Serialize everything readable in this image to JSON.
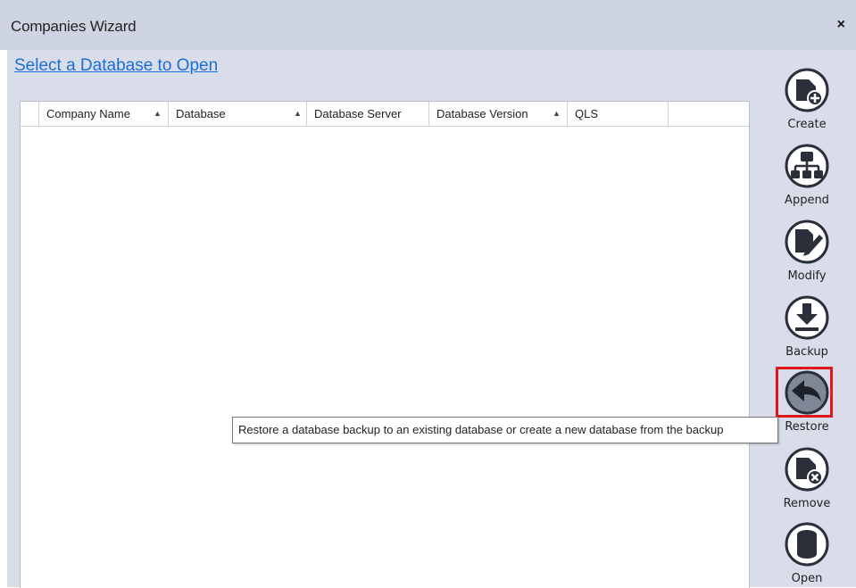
{
  "window": {
    "title": "Companies Wizard",
    "close_label": "×"
  },
  "main": {
    "heading": "Select a Database to Open"
  },
  "grid": {
    "columns": [
      {
        "label": "Company Name",
        "sort": "▲"
      },
      {
        "label": "Database",
        "sort": "▲"
      },
      {
        "label": "Database Server",
        "sort": ""
      },
      {
        "label": "Database Version",
        "sort": "▲"
      },
      {
        "label": "QLS",
        "sort": ""
      },
      {
        "label": "",
        "sort": ""
      }
    ],
    "rows": []
  },
  "actions": [
    {
      "label": "Create",
      "icon": "create-database-icon"
    },
    {
      "label": "Append",
      "icon": "append-hierarchy-icon"
    },
    {
      "label": "Modify",
      "icon": "modify-pencil-icon"
    },
    {
      "label": "Backup",
      "icon": "backup-download-icon"
    },
    {
      "label": "Restore",
      "icon": "restore-undo-icon",
      "highlighted": true
    },
    {
      "label": "Remove",
      "icon": "remove-database-icon"
    },
    {
      "label": "Open",
      "icon": "open-database-icon"
    }
  ],
  "tooltip": {
    "text": "Restore a database backup to an existing database or create a new database from the backup"
  },
  "colors": {
    "accent_link": "#1a6fd6",
    "highlight_border": "#e0161b",
    "icon_dark": "#2a2f3a",
    "icon_restore": "#7f8796",
    "window_bg": "#d9dde9"
  }
}
